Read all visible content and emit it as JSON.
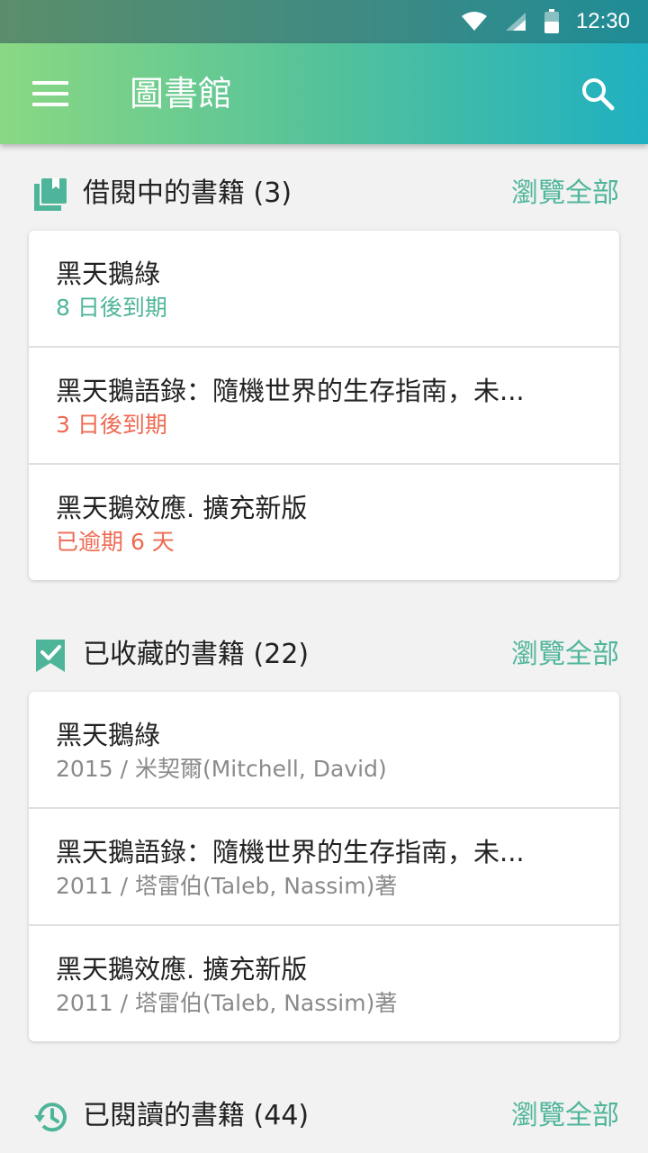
{
  "status_bar": {
    "time": "12:30"
  },
  "app_bar": {
    "title": "圖書館"
  },
  "sections": [
    {
      "title": "借閱中的書籍 (3)",
      "link": "瀏覽全部",
      "items": [
        {
          "title": "黑天鵝綠",
          "subtitle": "8 日後到期",
          "subtitle_status": "ok"
        },
        {
          "title": "黑天鵝語錄：隨機世界的生存指南，未...",
          "subtitle": "3 日後到期",
          "subtitle_status": "warning"
        },
        {
          "title": "黑天鵝效應. 擴充新版",
          "subtitle": "已逾期 6 天",
          "subtitle_status": "overdue"
        }
      ]
    },
    {
      "title": "已收藏的書籍 (22)",
      "link": "瀏覽全部",
      "items": [
        {
          "title": "黑天鵝綠",
          "subtitle": "2015 / 米契爾(Mitchell, David)"
        },
        {
          "title": "黑天鵝語錄：隨機世界的生存指南，未...",
          "subtitle": "2011 / 塔雷伯(Taleb, Nassim)著"
        },
        {
          "title": "黑天鵝效應. 擴充新版",
          "subtitle": "2011 / 塔雷伯(Taleb, Nassim)著"
        }
      ]
    },
    {
      "title": "已閱讀的書籍 (44)",
      "link": "瀏覽全部"
    }
  ],
  "colors": {
    "accent": "#4fb59a",
    "warning": "#ee6a52",
    "muted": "#8a8a8a"
  },
  "icons": [
    "menu-icon",
    "search-icon",
    "books-icon",
    "bookmark-check-icon",
    "history-icon",
    "wifi-icon",
    "signal-icon",
    "battery-icon"
  ]
}
